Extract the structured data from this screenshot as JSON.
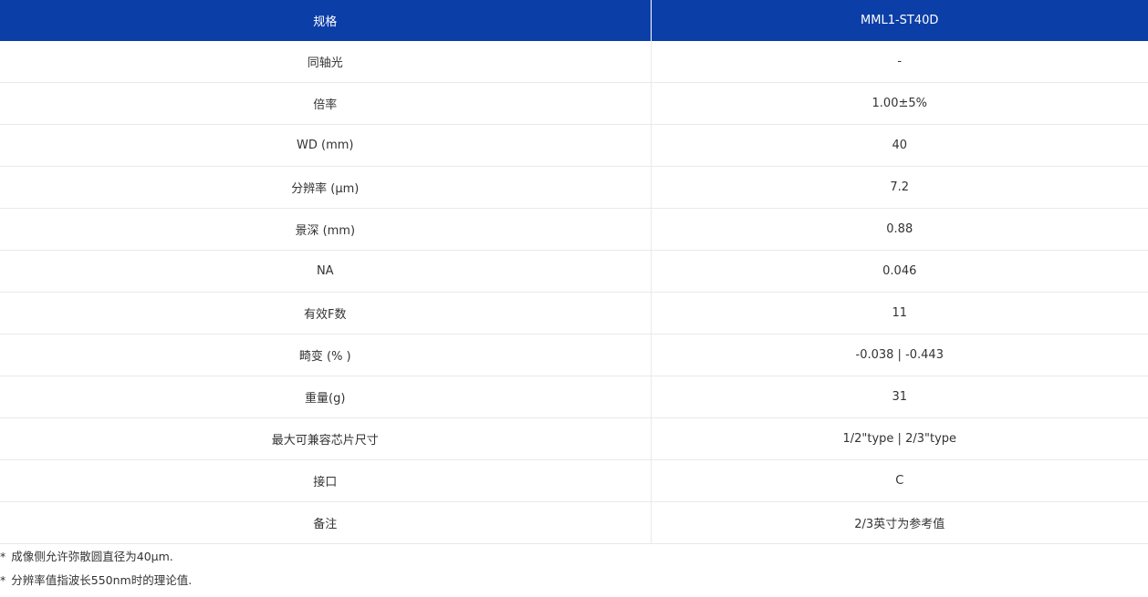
{
  "table": {
    "headers": [
      "规格",
      "MML1-ST40D"
    ],
    "rows": [
      {
        "label": "同轴光",
        "value": "-"
      },
      {
        "label": "倍率",
        "value": "1.00±5%"
      },
      {
        "label": "WD (mm)",
        "value": "40"
      },
      {
        "label": "分辨率 (μm)",
        "value": "7.2"
      },
      {
        "label": "景深 (mm)",
        "value": "0.88"
      },
      {
        "label": "NA",
        "value": "0.046"
      },
      {
        "label": "有效F数",
        "value": "11"
      },
      {
        "label": "畸变 (% )",
        "value": "-0.038 | -0.443"
      },
      {
        "label": "重量(g)",
        "value": "31"
      },
      {
        "label": "最大可兼容芯片尺寸",
        "value": "1/2\"type | 2/3\"type"
      },
      {
        "label": "接口",
        "value": "C"
      },
      {
        "label": "备注",
        "value": "2/3英寸为参考值"
      }
    ]
  },
  "notes": [
    {
      "mark": "*",
      "text": "成像侧允许弥散圆直径为40μm."
    },
    {
      "mark": "*",
      "text": "分辨率值指波长550nm时的理论值."
    }
  ],
  "colors": {
    "header_bg": "#0c3ea8",
    "header_text": "#ffffff",
    "row_border": "#e9e9e9",
    "body_text": "#333333"
  }
}
